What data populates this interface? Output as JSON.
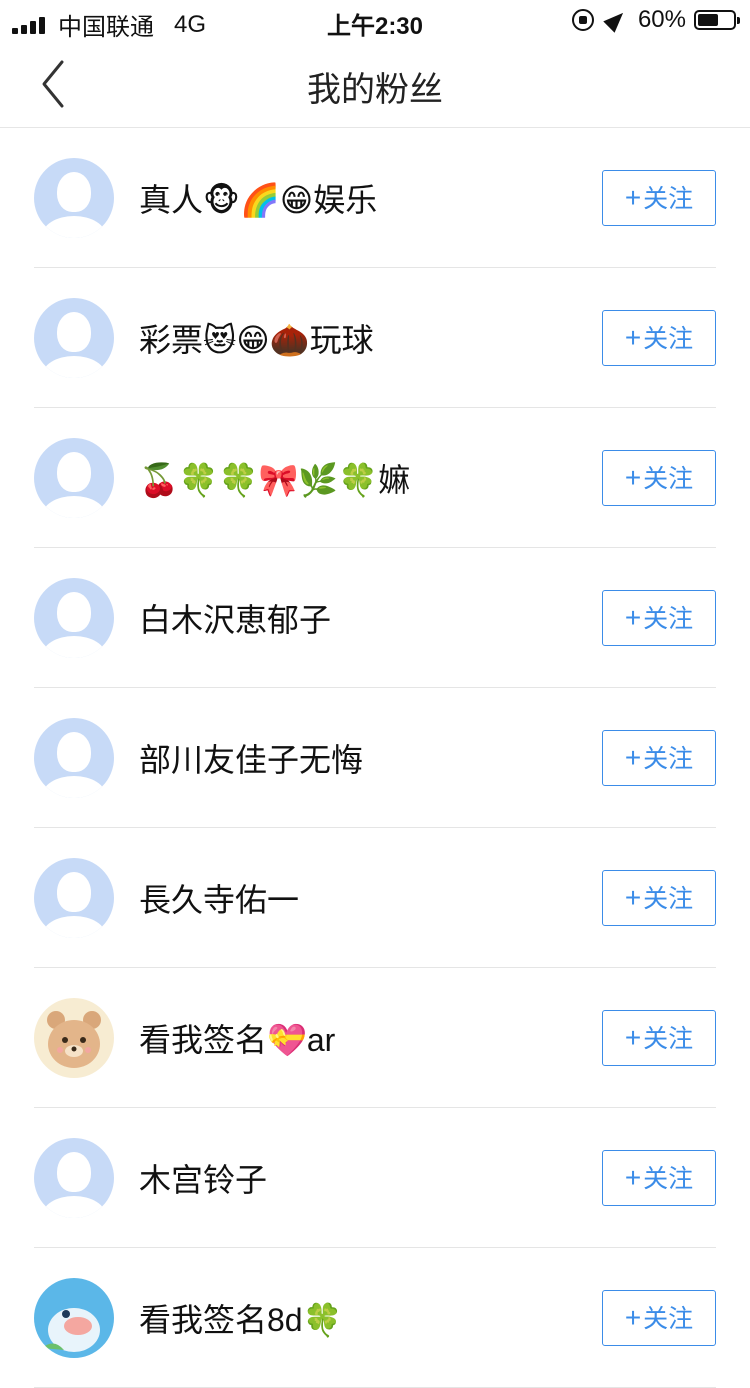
{
  "status_bar": {
    "carrier": "中国联通",
    "network": "4G",
    "time": "上午2:30",
    "battery": "60%",
    "battery_level": 0.6
  },
  "nav": {
    "title": "我的粉丝",
    "back_icon": "chevron-left-icon"
  },
  "follow_label": "关注",
  "follow_plus": "+",
  "followers": [
    {
      "name": "真人🐵🌈😁娱乐",
      "avatar": "default"
    },
    {
      "name": "彩票😻😁🌰玩球",
      "avatar": "default"
    },
    {
      "name": "🍒🍀🍀🎀🌿🍀嫲",
      "avatar": "default"
    },
    {
      "name": "白木沢恵郁子",
      "avatar": "default"
    },
    {
      "name": "部川友佳子无悔",
      "avatar": "default"
    },
    {
      "name": "長久寺佑一",
      "avatar": "default"
    },
    {
      "name": "看我签名💝ar",
      "avatar": "bear"
    },
    {
      "name": "木宫铃子",
      "avatar": "default"
    },
    {
      "name": "看我签名8d🍀",
      "avatar": "dolphin"
    }
  ],
  "colors": {
    "accent": "#3b8ce8",
    "avatar_default_bg": "#c7daf7",
    "divider": "#e5e5e5"
  }
}
